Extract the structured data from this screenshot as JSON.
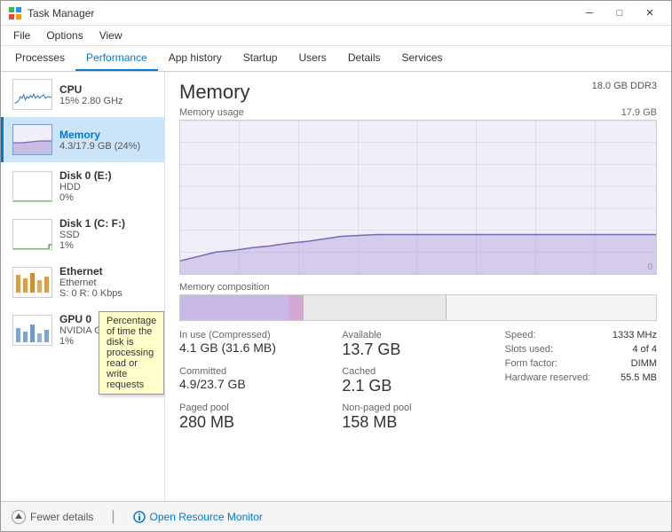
{
  "window": {
    "title": "Task Manager",
    "controls": {
      "minimize": "─",
      "maximize": "□",
      "close": "✕"
    }
  },
  "menu": {
    "items": [
      "File",
      "Options",
      "View"
    ]
  },
  "tabs": [
    {
      "label": "Processes",
      "active": false
    },
    {
      "label": "Performance",
      "active": true
    },
    {
      "label": "App history",
      "active": false
    },
    {
      "label": "Startup",
      "active": false
    },
    {
      "label": "Users",
      "active": false
    },
    {
      "label": "Details",
      "active": false
    },
    {
      "label": "Services",
      "active": false
    }
  ],
  "sidebar": {
    "items": [
      {
        "id": "cpu",
        "name": "CPU",
        "sub1": "15% 2.80 GHz",
        "active": false
      },
      {
        "id": "memory",
        "name": "Memory",
        "sub1": "4.3/17.9 GB (24%)",
        "active": true
      },
      {
        "id": "disk0",
        "name": "Disk 0 (E:)",
        "sub1": "HDD",
        "sub2": "0%",
        "active": false
      },
      {
        "id": "disk1",
        "name": "Disk 1 (C: F:)",
        "sub1": "SSD",
        "sub2": "1%",
        "active": false
      },
      {
        "id": "ethernet",
        "name": "Ethernet",
        "sub1": "Ethernet",
        "sub2": "S: 0 R: 0 Kbps",
        "active": false
      },
      {
        "id": "gpu",
        "name": "GPU 0",
        "sub1": "NVIDIA GeForce G...",
        "sub2": "1%",
        "active": false
      }
    ]
  },
  "tooltip": {
    "text": "Percentage of time the disk is processing read or write requests",
    "visible": true
  },
  "panel": {
    "title": "Memory",
    "spec_line1": "18.0 GB DDR3",
    "spec_line2": "",
    "graph": {
      "label": "Memory usage",
      "max_label": "17.9 GB",
      "min_label": "0"
    },
    "composition": {
      "label": "Memory composition"
    },
    "stats": {
      "in_use_label": "In use (Compressed)",
      "in_use_value": "4.1 GB (31.6 MB)",
      "available_label": "Available",
      "available_value": "13.7 GB",
      "committed_label": "Committed",
      "committed_value": "4.9/23.7 GB",
      "cached_label": "Cached",
      "cached_value": "2.1 GB",
      "paged_pool_label": "Paged pool",
      "paged_pool_value": "280 MB",
      "non_paged_pool_label": "Non-paged pool",
      "non_paged_pool_value": "158 MB"
    },
    "right_stats": {
      "speed_label": "Speed:",
      "speed_value": "1333 MHz",
      "slots_label": "Slots used:",
      "slots_value": "4 of 4",
      "form_label": "Form factor:",
      "form_value": "DIMM",
      "hw_reserved_label": "Hardware reserved:",
      "hw_reserved_value": "55.5 MB"
    }
  },
  "bottom": {
    "fewer_details_label": "Fewer details",
    "open_resource_monitor_label": "Open Resource Monitor"
  },
  "colors": {
    "memory_line": "#7b68b5",
    "memory_fill": "rgba(160,140,210,0.3)",
    "composition_in_use": "#c8b8e8",
    "composition_modified": "#d8a8c8",
    "composition_standby": "#e8e8e8",
    "composition_free": "#f5f5f5",
    "accent": "#0078d4",
    "graph_grid": "#e8e8e8",
    "graph_bg": "#f0f0f8"
  }
}
